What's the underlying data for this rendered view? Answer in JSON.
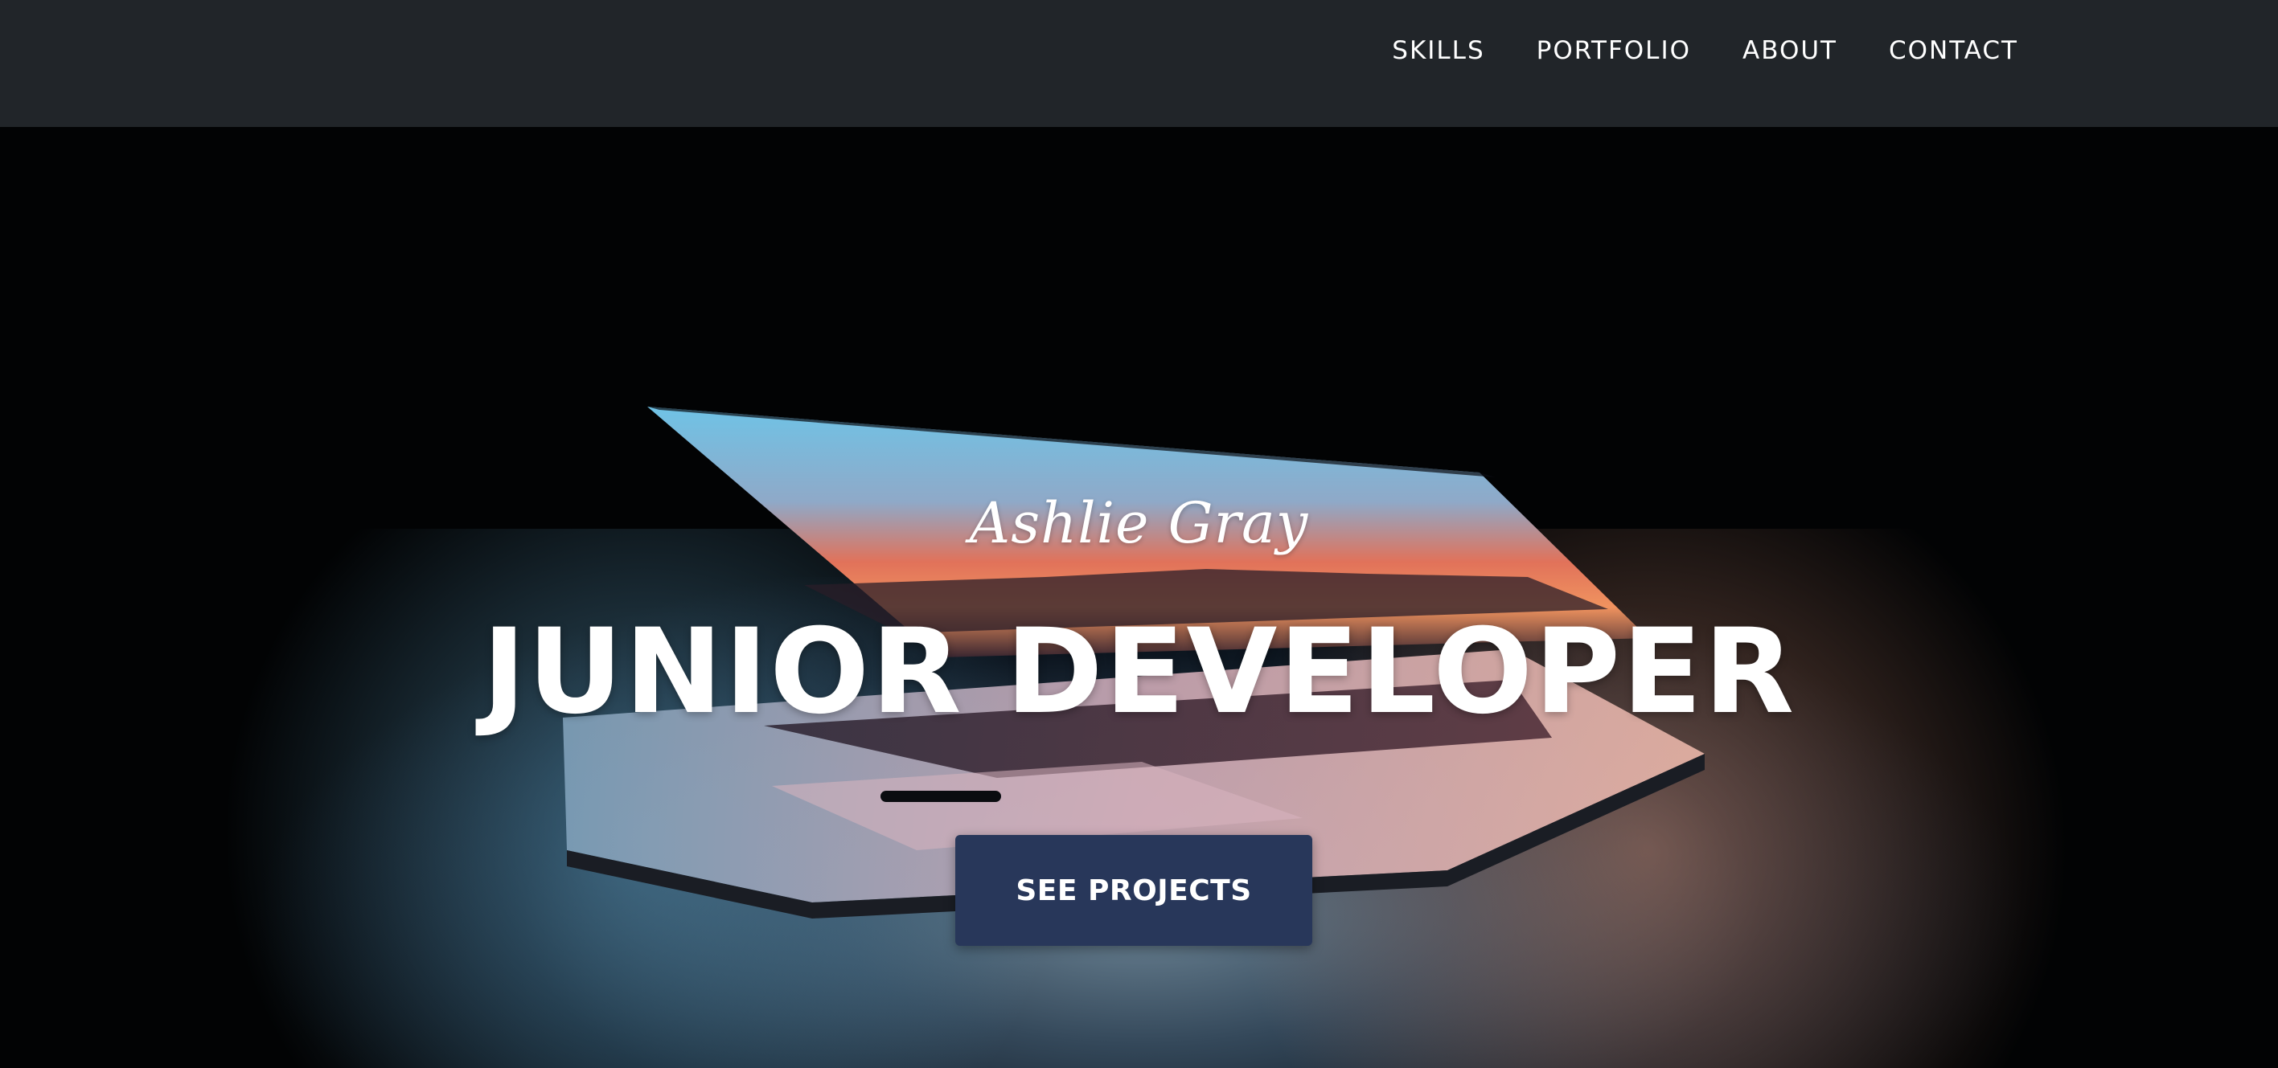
{
  "nav": {
    "items": [
      {
        "label": "SKILLS"
      },
      {
        "label": "PORTFOLIO"
      },
      {
        "label": "ABOUT"
      },
      {
        "label": "CONTACT"
      }
    ]
  },
  "hero": {
    "name": "Ashlie Gray",
    "title": "JUNIOR DEVELOPER",
    "cta_label": "SEE PROJECTS"
  },
  "colors": {
    "nav_background": "#212529",
    "hero_background": "#020304",
    "cta_background": "#28375a",
    "text": "#ffffff"
  }
}
